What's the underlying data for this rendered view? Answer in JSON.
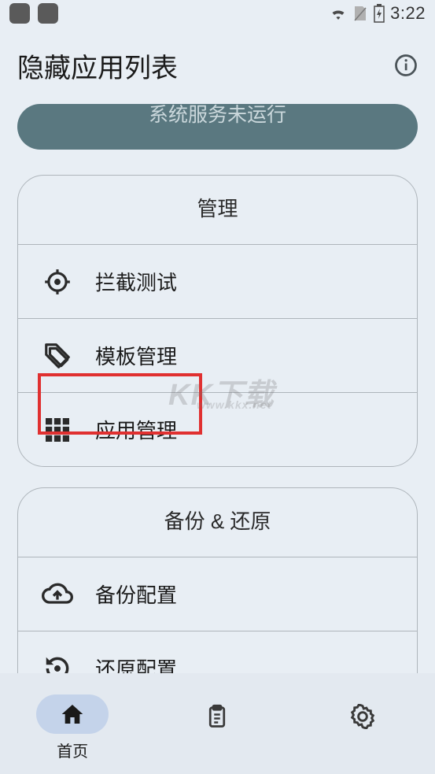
{
  "status": {
    "time": "3:22"
  },
  "header": {
    "title": "隐藏应用列表"
  },
  "banner": {
    "text": "系统服务未运行"
  },
  "sections": {
    "manage": {
      "title": "管理",
      "items": [
        {
          "label": "拦截测试"
        },
        {
          "label": "模板管理"
        },
        {
          "label": "应用管理"
        }
      ]
    },
    "backup": {
      "title": "备份 & 还原",
      "items": [
        {
          "label": "备份配置"
        },
        {
          "label": "还原配置"
        }
      ]
    }
  },
  "nav": {
    "home": "首页"
  },
  "watermark": {
    "main": "KK下载",
    "sub": "www.kkx.net"
  }
}
